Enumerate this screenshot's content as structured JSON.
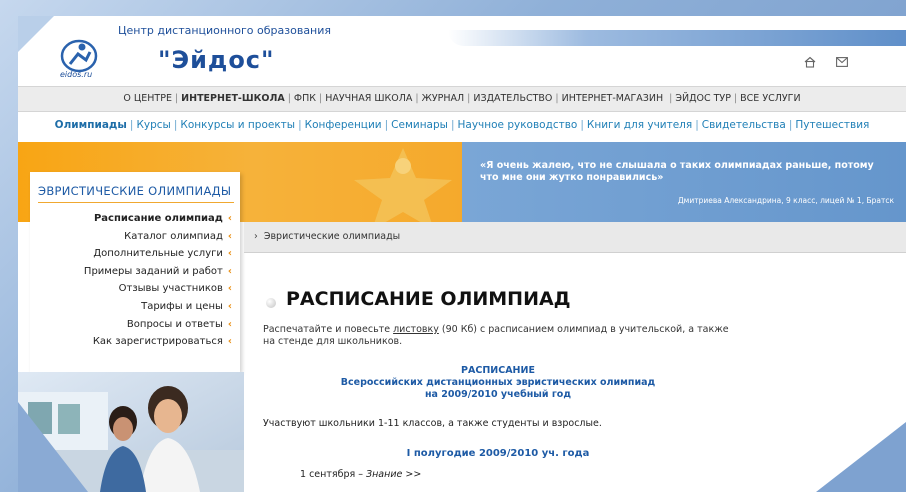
{
  "header": {
    "logo_small": "eidos.ru",
    "tagline": "Центр дистанционного образования",
    "brand": "\"Эйдос\""
  },
  "topnav": {
    "items": [
      "О ЦЕНТРЕ",
      "ИНТЕРНЕТ-ШКОЛА",
      "ФПК",
      "НАУЧНАЯ ШКОЛА",
      "ЖУРНАЛ",
      "ИЗДАТЕЛЬСТВО",
      "ИНТЕРНЕТ-МАГАЗИН",
      "ЭЙДОС ТУР",
      "ВСЕ УСЛУГИ"
    ]
  },
  "subnav": {
    "items": [
      "Олимпиады",
      "Курсы",
      "Конкурсы и проекты",
      "Конференции",
      "Семинары",
      "Научное руководство",
      "Книги для учителя",
      "Свидетельства",
      "Путешествия"
    ]
  },
  "banner": {
    "quote": "«Я очень жалею, что не слышала о таких олимпиадах раньше, потому что мне они жутко понравились»",
    "author": "Дмитриева Александрина, 9 класс, лицей № 1, Братск"
  },
  "sidebar": {
    "title": "ЭВРИСТИЧЕСКИЕ ОЛИМПИАДЫ",
    "items": [
      "Расписание олимпиад",
      "Каталог олимпиад",
      "Дополнительные услуги",
      "Примеры заданий и работ",
      "Отзывы участников",
      "Тарифы и цены",
      "Вопросы и ответы",
      "Как зарегистрироваться"
    ],
    "chevron": "‹"
  },
  "breadcrumb": {
    "arrow": "›",
    "text": "Эвристические олимпиады"
  },
  "main": {
    "title": "РАСПИСАНИЕ ОЛИМПИАД",
    "intro_before": "Распечатайте и повесьте ",
    "intro_link": "листовку",
    "intro_after": " (90 Кб) с расписанием олимпиад в учительской, а также на стенде для школьников.",
    "sched_line1": "РАСПИСАНИЕ",
    "sched_line2": "Всероссийских дистанционных эвристических олимпиад",
    "sched_line3": "на 2009/2010 учебный год",
    "participants": "Участвуют школьники 1-11 классов, а также студенты и взрослые.",
    "halfyear": "I полугодие 2009/2010 уч. года",
    "first_date": "1 сентября –",
    "first_event": "Знание >>"
  }
}
